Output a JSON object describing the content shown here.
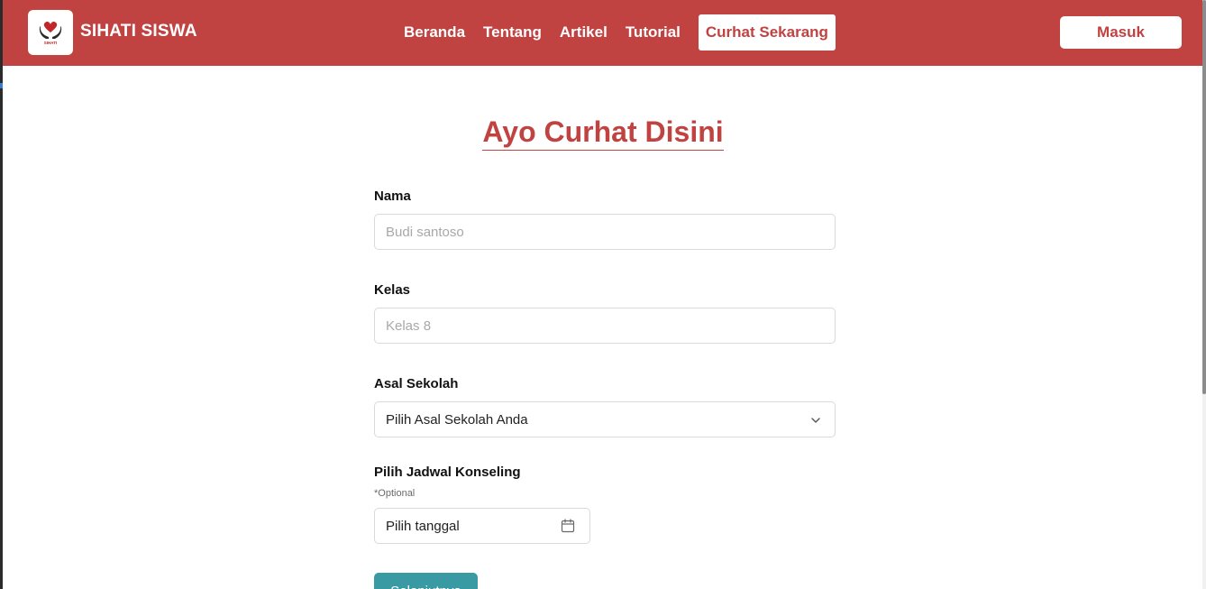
{
  "navbar": {
    "brand": "SIHATI SISWA",
    "logo_icon": "heart-hands-logo-icon",
    "logo_text": "SIHATI",
    "links": [
      "Beranda",
      "Tentang",
      "Artikel",
      "Tutorial"
    ],
    "cta": "Curhat Sekarang",
    "login": "Masuk",
    "bg_color": "#c04342"
  },
  "main": {
    "title": "Ayo Curhat Disini",
    "fields": {
      "nama": {
        "label": "Nama",
        "placeholder": "Budi santoso",
        "value": ""
      },
      "kelas": {
        "label": "Kelas",
        "placeholder": "Kelas 8",
        "value": ""
      },
      "sekolah": {
        "label": "Asal Sekolah",
        "selected": "Pilih Asal Sekolah Anda"
      },
      "jadwal": {
        "label": "Pilih Jadwal Konseling",
        "note": "*Optional",
        "value": "Pilih tanggal"
      }
    },
    "next_button": "Selanjutnya",
    "accent_color": "#c04342",
    "button_color": "#3a9aa3"
  }
}
